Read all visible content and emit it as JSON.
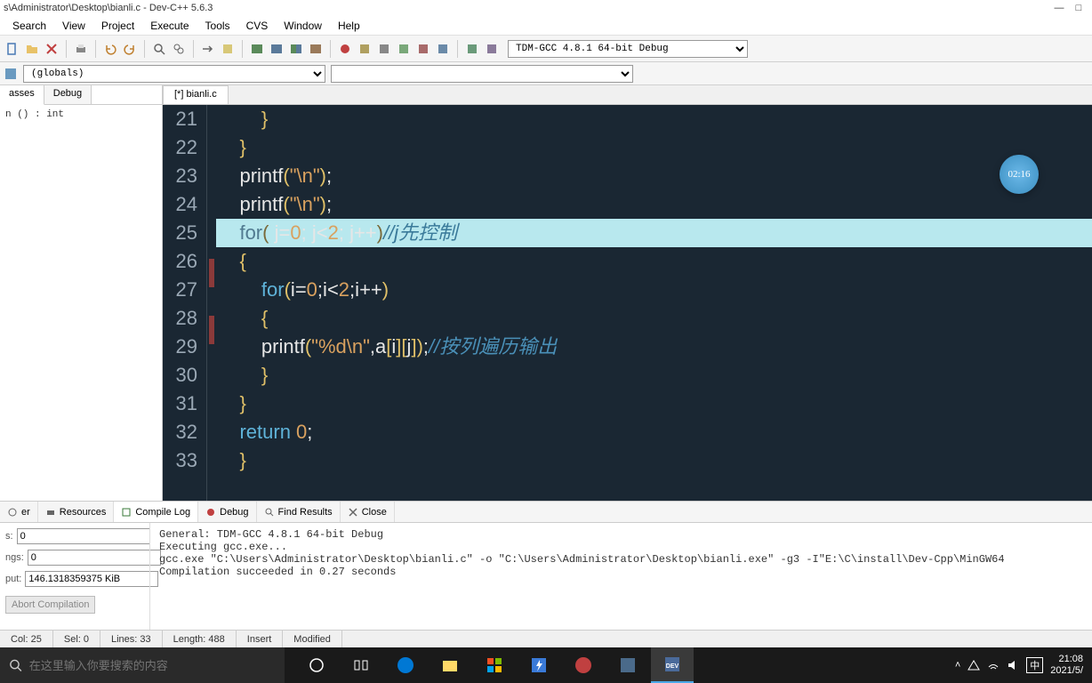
{
  "titlebar": {
    "path": "s\\Administrator\\Desktop\\bianli.c - Dev-C++ 5.6.3"
  },
  "menu": {
    "items": [
      "Search",
      "View",
      "Project",
      "Execute",
      "Tools",
      "CVS",
      "Window",
      "Help"
    ]
  },
  "toolbar": {
    "compiler": "TDM-GCC 4.8.1 64-bit Debug"
  },
  "scopebar": {
    "globals": "(globals)",
    "members": ""
  },
  "left_panel": {
    "tabs": [
      "asses",
      "Debug"
    ],
    "symbol": "n () : int"
  },
  "editor": {
    "tab": "[*] bianli.c",
    "first_line": 21,
    "timer": "02:16",
    "lines": [
      {
        "indent": 2,
        "tokens": [
          {
            "t": "}",
            "c": "pun"
          }
        ]
      },
      {
        "indent": 1,
        "tokens": [
          {
            "t": "}",
            "c": "pun"
          }
        ]
      },
      {
        "indent": 1,
        "tokens": [
          {
            "t": "printf",
            "c": "sym2"
          },
          {
            "t": "(",
            "c": "pun"
          },
          {
            "t": "\"\\n\"",
            "c": "str"
          },
          {
            "t": ")",
            "c": "pun"
          },
          {
            "t": ";",
            "c": "sym2"
          }
        ]
      },
      {
        "indent": 1,
        "tokens": [
          {
            "t": "printf",
            "c": "sym2"
          },
          {
            "t": "(",
            "c": "pun"
          },
          {
            "t": "\"\\n\"",
            "c": "str"
          },
          {
            "t": ")",
            "c": "pun"
          },
          {
            "t": ";",
            "c": "sym2"
          }
        ]
      },
      {
        "indent": 1,
        "hl": true,
        "tokens": [
          {
            "t": "for",
            "c": "kw"
          },
          {
            "t": "( ",
            "c": "pun"
          },
          {
            "t": "j",
            "c": "sym2"
          },
          {
            "t": "=",
            "c": "sym2"
          },
          {
            "t": "0",
            "c": "num-lit"
          },
          {
            "t": "; ",
            "c": "sym2"
          },
          {
            "t": "j",
            "c": "sym2"
          },
          {
            "t": "<",
            "c": "sym2"
          },
          {
            "t": "2",
            "c": "num-lit"
          },
          {
            "t": "; ",
            "c": "sym2"
          },
          {
            "t": "j",
            "c": "sym2"
          },
          {
            "t": "++",
            "c": "sym2"
          },
          {
            "t": ")",
            "c": "pun"
          },
          {
            "t": "//j先控制",
            "c": "cmt"
          }
        ]
      },
      {
        "indent": 1,
        "fold": true,
        "tokens": [
          {
            "t": "{",
            "c": "pun"
          }
        ]
      },
      {
        "indent": 2,
        "tokens": [
          {
            "t": "for",
            "c": "kw"
          },
          {
            "t": "(",
            "c": "pun"
          },
          {
            "t": "i",
            "c": "sym2"
          },
          {
            "t": "=",
            "c": "sym2"
          },
          {
            "t": "0",
            "c": "num-lit"
          },
          {
            "t": ";",
            "c": "sym2"
          },
          {
            "t": "i",
            "c": "sym2"
          },
          {
            "t": "<",
            "c": "sym2"
          },
          {
            "t": "2",
            "c": "num-lit"
          },
          {
            "t": ";",
            "c": "sym2"
          },
          {
            "t": "i",
            "c": "sym2"
          },
          {
            "t": "++",
            "c": "sym2"
          },
          {
            "t": ")",
            "c": "pun"
          }
        ]
      },
      {
        "indent": 2,
        "fold": true,
        "tokens": [
          {
            "t": "{",
            "c": "pun"
          }
        ]
      },
      {
        "indent": 2,
        "tokens": [
          {
            "t": "printf",
            "c": "sym2"
          },
          {
            "t": "(",
            "c": "pun"
          },
          {
            "t": "\"%d\\n\"",
            "c": "str"
          },
          {
            "t": ",a",
            "c": "sym2"
          },
          {
            "t": "[",
            "c": "pun"
          },
          {
            "t": "i",
            "c": "sym2"
          },
          {
            "t": "]",
            "c": "pun"
          },
          {
            "t": "[",
            "c": "pun"
          },
          {
            "t": "j",
            "c": "sym2"
          },
          {
            "t": "]",
            "c": "pun"
          },
          {
            "t": ")",
            "c": "pun"
          },
          {
            "t": ";",
            "c": "sym2"
          },
          {
            "t": "//按列遍历输出",
            "c": "cmt"
          }
        ]
      },
      {
        "indent": 2,
        "tokens": [
          {
            "t": "}",
            "c": "pun"
          }
        ]
      },
      {
        "indent": 1,
        "tokens": [
          {
            "t": "}",
            "c": "pun"
          }
        ]
      },
      {
        "indent": 1,
        "tokens": [
          {
            "t": "return ",
            "c": "kw"
          },
          {
            "t": "0",
            "c": "num-lit"
          },
          {
            "t": ";",
            "c": "sym2"
          }
        ]
      },
      {
        "indent": 1,
        "tokens": [
          {
            "t": "}",
            "c": "pun"
          }
        ]
      }
    ]
  },
  "bottom": {
    "tabs": [
      {
        "label": "er",
        "icon": "gear"
      },
      {
        "label": "Resources",
        "icon": "printer"
      },
      {
        "label": "Compile Log",
        "icon": "log",
        "active": true
      },
      {
        "label": "Debug",
        "icon": "bug"
      },
      {
        "label": "Find Results",
        "icon": "search"
      },
      {
        "label": "Close",
        "icon": "x"
      }
    ],
    "fields": {
      "s": "0",
      "ngs": "0",
      "put": "146.1318359375 KiB"
    },
    "field_labels": {
      "s": "s:",
      "ngs": "ngs:",
      "put": "put:"
    },
    "abort": "Abort Compilation",
    "log": "General: TDM-GCC 4.8.1 64-bit Debug\nExecuting gcc.exe...\ngcc.exe \"C:\\Users\\Administrator\\Desktop\\bianli.c\" -o \"C:\\Users\\Administrator\\Desktop\\bianli.exe\" -g3 -I\"E:\\C\\install\\Dev-Cpp\\MinGW64\nCompilation succeeded in 0.27 seconds"
  },
  "status": {
    "col": "Col:   25",
    "sel": "Sel:   0",
    "lines": "Lines:   33",
    "length": "Length:   488",
    "insert": "Insert",
    "modified": "Modified"
  },
  "taskbar": {
    "search_placeholder": "在这里输入你要搜索的内容",
    "time": "21:08",
    "date": "2021/5/",
    "ime": "中"
  }
}
